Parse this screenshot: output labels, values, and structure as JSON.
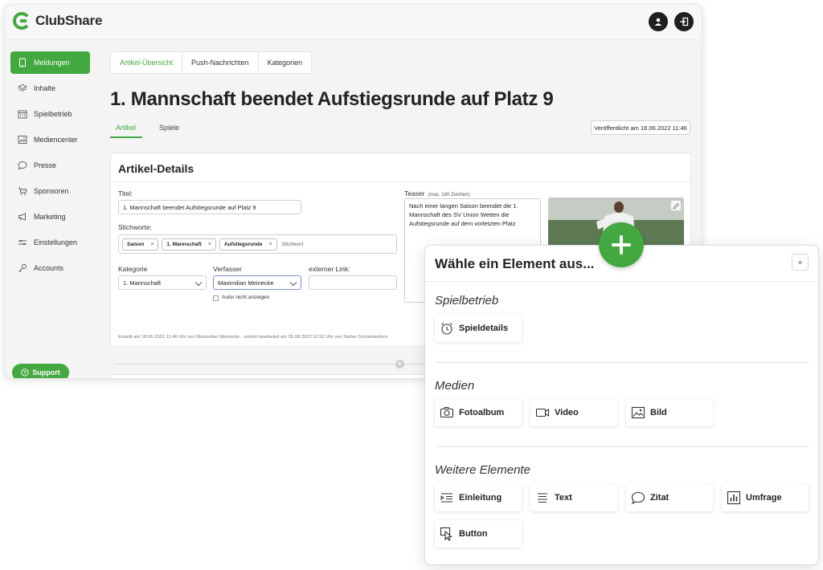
{
  "app": {
    "name": "ClubShare",
    "brand_color": "#43a83f"
  },
  "topbar": {
    "icons": [
      "user-icon",
      "logout-icon"
    ]
  },
  "sidebar": {
    "items": [
      {
        "label": "Meldungen",
        "icon": "tablet-icon",
        "active": true
      },
      {
        "label": "Inhalte",
        "icon": "layers-icon"
      },
      {
        "label": "Spielbetrieb",
        "icon": "calendar-icon"
      },
      {
        "label": "Mediencenter",
        "icon": "image-icon"
      },
      {
        "label": "Presse",
        "icon": "speech-bubble-icon"
      },
      {
        "label": "Sponsoren",
        "icon": "cart-icon"
      },
      {
        "label": "Marketing",
        "icon": "megaphone-icon"
      },
      {
        "label": "Einstellungen",
        "icon": "sliders-icon"
      },
      {
        "label": "Accounts",
        "icon": "key-icon"
      }
    ],
    "support_label": "Support"
  },
  "main": {
    "tabs": [
      "Artikel-Übersicht",
      "Push-Nachrichten",
      "Kategorien"
    ],
    "title": "1. Mannschaft beendet Aufstiegsrunde auf Platz 9",
    "subtabs": [
      "Artikel",
      "Spiele"
    ],
    "published": "Veröffentlicht am 18.06.2022 11:46"
  },
  "details": {
    "heading": "Artikel-Details",
    "title_label": "Titel:",
    "title_value": "1. Mannschaft beendet Aufstiegsrunde auf Platz 9",
    "keywords_label": "Stichworte:",
    "keywords": [
      "Saison",
      "1. Mannschaft",
      "Aufstiegsrunde"
    ],
    "keyword_placeholder": "Stichwort",
    "category_label": "Kategorie",
    "category_value": "1. Mannschaft",
    "author_label": "Verfasser",
    "author_value": "Maximilian Meinecke",
    "external_link_label": "externer Link:",
    "hide_author_label": "Autor nicht anzeigen",
    "teaser_label": "Teaser",
    "teaser_hint": "(max. 180 Zeichen):",
    "teaser_value": "Nach einer langen Saison beendet die 1. Mannschaft des SV Union Wetten die Aufstiegsrunde auf dem vorletzten Platz",
    "footnote": "Erstellt am 18.06.2022 11:46 Uhr von Maximilian Meinecke  ·  zuletzt bearbeitet am 05.08.2022 12:52 Uhr von Stefan Schniedertöns"
  },
  "modal": {
    "title": "Wähle ein Element aus...",
    "close": "×",
    "sections": [
      {
        "title": "Spielbetrieb",
        "items": [
          {
            "label": "Spieldetails",
            "icon": "alarm-clock-icon"
          }
        ]
      },
      {
        "title": "Medien",
        "items": [
          {
            "label": "Fotoalbum",
            "icon": "camera-icon"
          },
          {
            "label": "Video",
            "icon": "video-camera-icon"
          },
          {
            "label": "Bild",
            "icon": "picture-icon"
          }
        ]
      },
      {
        "title": "Weitere Elemente",
        "items": [
          {
            "label": "Einleitung",
            "icon": "intro-lines-icon"
          },
          {
            "label": "Text",
            "icon": "text-lines-icon"
          },
          {
            "label": "Zitat",
            "icon": "quote-bubble-icon"
          },
          {
            "label": "Umfrage",
            "icon": "poll-chart-icon"
          },
          {
            "label": "Button",
            "icon": "cursor-click-icon"
          }
        ]
      }
    ]
  }
}
